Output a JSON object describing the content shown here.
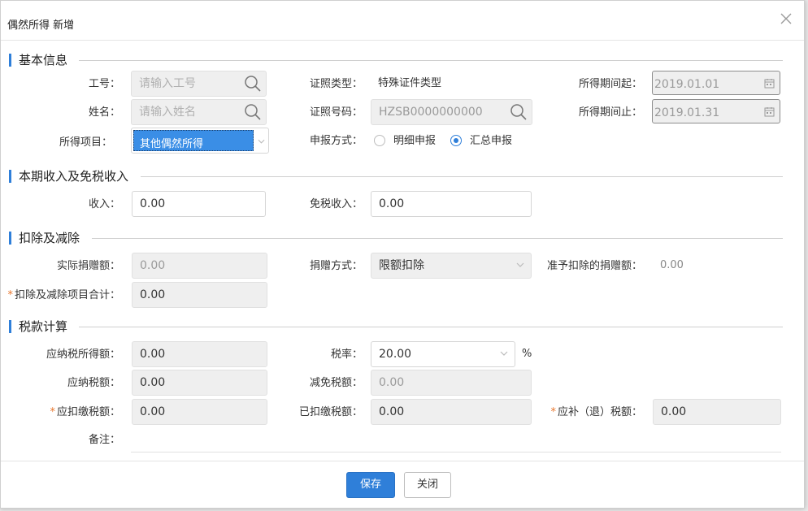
{
  "dialog": {
    "title": "偶然所得 新增"
  },
  "sections": {
    "basic": "基本信息",
    "income": "本期收入及免税收入",
    "deduction": "扣除及减除",
    "tax": "税款计算"
  },
  "basic": {
    "emp_no_label": "工号：",
    "emp_no_placeholder": "请输入工号",
    "name_label": "姓名：",
    "name_placeholder": "请输入姓名",
    "item_label": "所得项目：",
    "item_value": "其他偶然所得",
    "id_type_label": "证照类型：",
    "id_type_value": "特殊证件类型",
    "id_no_label": "证照号码：",
    "id_no_value": "HZSB0000000000",
    "report_label": "申报方式：",
    "report_options": [
      "明细申报",
      "汇总申报"
    ],
    "report_selected": "汇总申报",
    "period_start_label": "所得期间起：",
    "period_start_value": "2019.01.01",
    "period_end_label": "所得期间止：",
    "period_end_value": "2019.01.31"
  },
  "income": {
    "income_label": "收入：",
    "income_value": "0.00",
    "exempt_label": "免税收入：",
    "exempt_value": "0.00"
  },
  "deduction": {
    "donation_label": "实际捐赠额：",
    "donation_value": "0.00",
    "donation_method_label": "捐赠方式：",
    "donation_method_value": "限额扣除",
    "allowed_label": "准予扣除的捐赠额：",
    "allowed_value": "0.00",
    "total_label": "扣除及减除项目合计：",
    "total_value": "0.00"
  },
  "tax": {
    "taxable_label": "应纳税所得额：",
    "taxable_value": "0.00",
    "rate_label": "税率：",
    "rate_value": "20.00",
    "rate_unit": "%",
    "payable_label": "应纳税额：",
    "payable_value": "0.00",
    "relief_label": "减免税额：",
    "relief_value": "0.00",
    "withhold_label": "应扣缴税额：",
    "withhold_value": "0.00",
    "withheld_label": "已扣缴税额：",
    "withheld_value": "0.00",
    "refund_label": "应补（退）税额：",
    "refund_value": "0.00",
    "notes_label": "备注："
  },
  "footer": {
    "save": "保存",
    "close": "关闭"
  },
  "colors": {
    "accent": "#2f7fd9",
    "required": "#e8772e"
  }
}
